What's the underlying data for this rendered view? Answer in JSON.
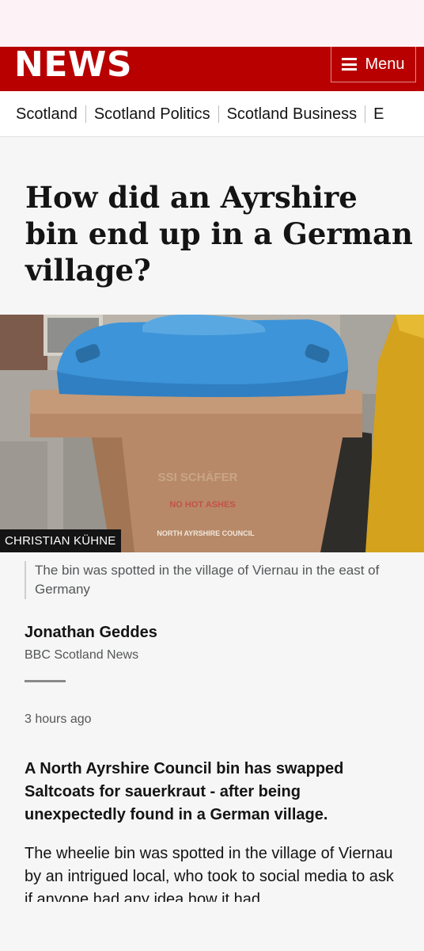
{
  "header": {
    "brand": "NEWS",
    "menu_label": "Menu"
  },
  "subnav": {
    "items": [
      "Scotland",
      "Scotland Politics",
      "Scotland Business",
      "E"
    ]
  },
  "article": {
    "headline": "How did an Ayrshire bin end up in a German village?",
    "image": {
      "credit": "CHRISTIAN KÜHNE",
      "bin_label_maker": "SSI SCHÄFER",
      "bin_label_warning": "NO HOT ASHES",
      "bin_label_council": "NORTH AYRSHIRE COUNCIL"
    },
    "caption": "The bin was spotted in the village of Viernau in the east of Germany",
    "author": "Jonathan Geddes",
    "author_role": "BBC Scotland News",
    "timestamp": "3 hours ago",
    "lead": "A North Ayrshire Council bin has swapped Saltcoats for sauerkraut - after being unexpectedly found in a German village.",
    "body": "The wheelie bin was spotted in the village of Viernau by an intrigued local, who took to social media to ask if anyone had any idea how it had"
  },
  "colors": {
    "brand_red": "#b80000",
    "lid_blue": "#3d94d8",
    "bin_brown": "#b78968"
  }
}
